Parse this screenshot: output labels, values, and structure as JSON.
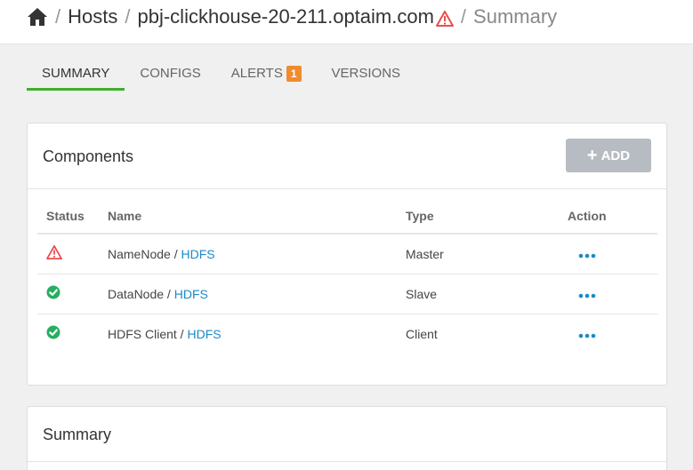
{
  "breadcrumb": {
    "home_icon": "home-icon",
    "hosts": "Hosts",
    "host": "pbj-clickhouse-20-211.optaim.com",
    "host_status_icon": "warning-icon",
    "current": "Summary",
    "separator": "/"
  },
  "tabs": [
    {
      "label": "SUMMARY",
      "active": true
    },
    {
      "label": "CONFIGS",
      "active": false
    },
    {
      "label": "ALERTS",
      "badge": "1",
      "active": false
    },
    {
      "label": "VERSIONS",
      "active": false
    }
  ],
  "components": {
    "title": "Components",
    "add_label": "ADD",
    "columns": {
      "status": "Status",
      "name": "Name",
      "type": "Type",
      "action": "Action"
    },
    "rows": [
      {
        "status_icon": "warning-icon",
        "name": "NameNode",
        "sep": " / ",
        "service": "HDFS",
        "type": "Master"
      },
      {
        "status_icon": "check-circle-icon",
        "name": "DataNode",
        "sep": " / ",
        "service": "HDFS",
        "type": "Slave"
      },
      {
        "status_icon": "check-circle-icon",
        "name": "HDFS Client",
        "sep": " / ",
        "service": "HDFS",
        "type": "Client"
      }
    ]
  },
  "summary": {
    "title": "Summary"
  },
  "colors": {
    "active_tab": "#3fae2a",
    "badge": "#f08c2e",
    "warning": "#e94e4e",
    "ok": "#27ae60",
    "link": "#1a8ac7"
  }
}
